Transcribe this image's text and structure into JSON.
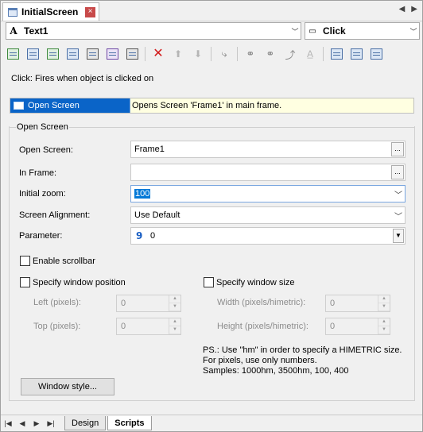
{
  "tabs": {
    "document_title": "InitialScreen",
    "close_label": "×",
    "prev": "◀",
    "next": "▶"
  },
  "object_combo": {
    "icon": "A",
    "value": "Text1"
  },
  "event_combo": {
    "value": "Click"
  },
  "toolbar": {
    "icons": [
      "add-action-icon",
      "add-script-icon",
      "add-image-icon",
      "add-list-icon",
      "import-icon",
      "refresh-icon",
      "print-icon",
      "delete-icon",
      "move-up-icon",
      "move-down-icon",
      "cursor-icon",
      "binoculars-icon",
      "find-next-icon",
      "replace-icon",
      "text-replace-icon",
      "doc-icon",
      "doc-check-icon",
      "doc-list-icon"
    ]
  },
  "description": "Click: Fires when object is clicked on",
  "action": {
    "name": "Open Screen",
    "detail": "Opens Screen 'Frame1' in main frame."
  },
  "group": {
    "title": "Open Screen"
  },
  "fields": {
    "open_screen": {
      "label": "Open Screen:",
      "value": "Frame1",
      "button": "..."
    },
    "in_frame": {
      "label": "In Frame:",
      "value": "",
      "button": "..."
    },
    "initial_zoom": {
      "label": "Initial zoom:",
      "value": "100"
    },
    "screen_alignment": {
      "label": "Screen Alignment:",
      "value": "Use Default"
    },
    "parameter": {
      "label": "Parameter:",
      "value": "0",
      "icon": "9"
    }
  },
  "enable_scrollbar": {
    "label": "Enable scrollbar",
    "checked": false
  },
  "window_position": {
    "label": "Specify window position",
    "checked": false,
    "left_label": "Left (pixels):",
    "left_value": "0",
    "top_label": "Top (pixels):",
    "top_value": "0"
  },
  "window_size": {
    "label": "Specify window size",
    "checked": false,
    "width_label": "Width (pixels/himetric):",
    "width_value": "0",
    "height_label": "Height (pixels/himetric):",
    "height_value": "0"
  },
  "note": {
    "line1": "PS.: Use \"hm\" in order to specify a HIMETRIC size.",
    "line2": "For pixels, use only numbers.",
    "line3": "Samples: 1000hm, 3500hm, 100, 400"
  },
  "window_style_button": "Window style...",
  "bottom": {
    "nav": [
      "|◀",
      "◀",
      "▶",
      "▶|"
    ],
    "tabs": [
      "Design",
      "Scripts"
    ],
    "active_tab": "Scripts"
  }
}
